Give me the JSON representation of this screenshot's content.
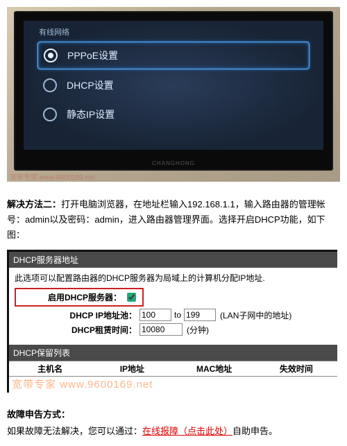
{
  "tv": {
    "title": "有线网络",
    "options": [
      {
        "label": "PPPoE设置",
        "selected": true
      },
      {
        "label": "DHCP设置",
        "selected": false
      },
      {
        "label": "静态IP设置",
        "selected": false
      }
    ],
    "brand": "CHANGHONG",
    "watermark": "宽带专家 www.9600169.net"
  },
  "method2": {
    "prefix": "解决方法二：",
    "text": "打开电脑浏览器，在地址栏输入192.168.1.1，输入路由器的管理帐号：admin以及密码：admin，进入路由器管理界面。选择开启DHCP功能，如下图："
  },
  "router": {
    "head1": "DHCP服务器地址",
    "note": "此选项可以配置路由器的DHCP服务器为局域上的计算机分配IP地址.",
    "enable_label": "启用DHCP服务器：",
    "pool_label": "DHCP IP地址池：",
    "pool_from": "100",
    "pool_sep": "to",
    "pool_to": "199",
    "pool_hint": "(LAN子网中的地址)",
    "lease_label": "DHCP租赁时间：",
    "lease_value": "10080",
    "lease_hint": "(分钟)",
    "head2": "DHCP保留列表",
    "cols": {
      "host": "主机名",
      "ip": "IP地址",
      "mac": "MAC地址",
      "expire": "失效时间"
    },
    "watermark": "宽带专家 www.9600169.net"
  },
  "report": {
    "heading": "故障申告方式：",
    "line_pre": "如果故障无法解决，您可以通过：",
    "link": "在线报障（点击此处）",
    "line_post": "自助申告。"
  }
}
